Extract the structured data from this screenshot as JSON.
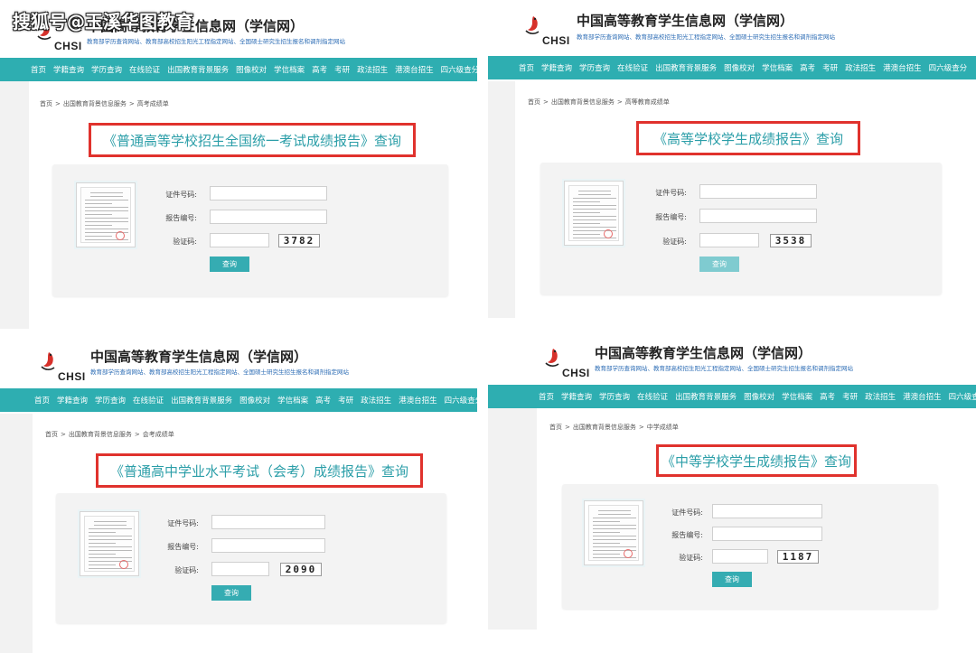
{
  "watermark": "搜狐号@玉溪华图教育",
  "site": {
    "logo_text": "CHSI",
    "title": "中国高等教育学生信息网（学信网）",
    "subtitle": "教育部学历查询网站、教育部高校招生阳光工程指定网站、全国硕士研究生招生报名和调剂指定网站"
  },
  "nav_items": [
    "首页",
    "学籍查询",
    "学历查询",
    "在线验证",
    "出国教育背景服务",
    "图像校对",
    "学信档案",
    "高考",
    "考研",
    "政法招生",
    "港澳台招生",
    "四六级查分"
  ],
  "labels": {
    "cert_no": "证件号码:",
    "report_no": "报告编号:",
    "captcha": "验证码:",
    "query_button": "查询"
  },
  "panels": [
    {
      "breadcrumb": [
        "首页",
        ">",
        "出国教育背景信息服务",
        ">",
        "高考成绩单"
      ],
      "report_title": "《普通高等学校招生全国统一考试成绩报告》查询",
      "captcha_code": "3782"
    },
    {
      "breadcrumb": [
        "首页",
        ">",
        "出国教育背景信息服务",
        ">",
        "高等教育成绩单"
      ],
      "report_title": "《高等学校学生成绩报告》查询",
      "captcha_code": "3538"
    },
    {
      "breadcrumb": [
        "首页",
        ">",
        "出国教育背景信息服务",
        ">",
        "会考成绩单"
      ],
      "report_title": "《普通高中学业水平考试（会考）成绩报告》查询",
      "captcha_code": "2090"
    },
    {
      "breadcrumb": [
        "首页",
        ">",
        "出国教育背景信息服务",
        ">",
        "中学成绩单"
      ],
      "report_title": "《中等学校学生成绩报告》查询",
      "captcha_code": "1187"
    }
  ],
  "colors": {
    "nav_bg": "#2eaeb1",
    "title_box_border": "#e0322d",
    "title_text": "#2b9ea8",
    "button_bg": "#35acb2"
  }
}
